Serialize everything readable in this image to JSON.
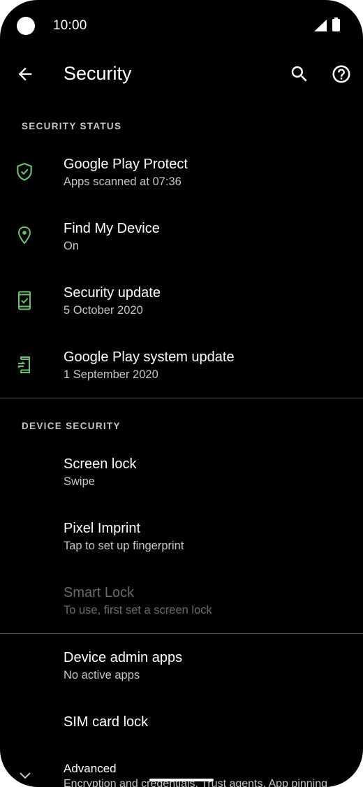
{
  "status_bar": {
    "time": "10:00"
  },
  "app_bar": {
    "title": "Security",
    "icons": [
      "back-arrow-icon",
      "search-icon",
      "help-icon"
    ]
  },
  "colors": {
    "accent": "#6abf69",
    "background": "#000000",
    "divider": "#5c5c5c"
  },
  "security_status": {
    "header": "SECURITY STATUS",
    "items": [
      {
        "title": "Google Play Protect",
        "subtitle": "Apps scanned at 07:36",
        "icon": "shield-check-icon"
      },
      {
        "title": "Find My Device",
        "subtitle": "On",
        "icon": "location-pin-icon"
      },
      {
        "title": "Security update",
        "subtitle": "5 October 2020",
        "icon": "phone-check-icon"
      },
      {
        "title": "Google Play system update",
        "subtitle": "1 September 2020",
        "icon": "phone-sync-icon"
      }
    ]
  },
  "device_security": {
    "header": "DEVICE SECURITY",
    "items": [
      {
        "title": "Screen lock",
        "subtitle": "Swipe"
      },
      {
        "title": "Pixel Imprint",
        "subtitle": "Tap to set up fingerprint"
      },
      {
        "title": "Smart Lock",
        "subtitle": "To use, first set a screen lock"
      }
    ]
  },
  "other": {
    "items": [
      {
        "title": "Device admin apps",
        "subtitle": "No active apps"
      },
      {
        "title": "SIM card lock"
      }
    ]
  },
  "advanced": {
    "title": "Advanced",
    "subtitle": "Encryption and credentials, Trust agents, App pinning",
    "icon": "chevron-down-icon"
  }
}
